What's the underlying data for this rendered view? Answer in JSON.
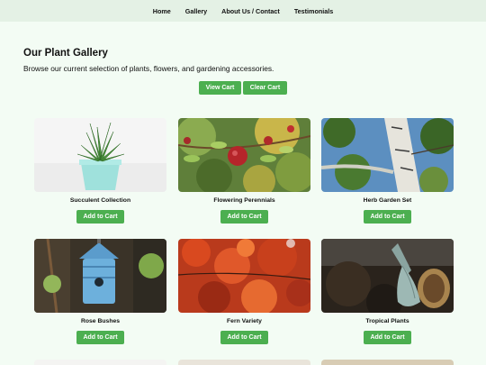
{
  "nav": {
    "items": [
      {
        "label": "Home"
      },
      {
        "label": "Gallery"
      },
      {
        "label": "About Us / Contact"
      },
      {
        "label": "Testimonials"
      }
    ]
  },
  "gallery": {
    "title": "Our Plant Gallery",
    "subtitle": "Browse our current selection of plants, flowers, and gardening accessories.",
    "view_cart_label": "View Cart",
    "clear_cart_label": "Clear Cart"
  },
  "products": [
    {
      "name": "Succulent Collection",
      "button": "Add to Cart"
    },
    {
      "name": "Flowering Perennials",
      "button": "Add to Cart"
    },
    {
      "name": "Herb Garden Set",
      "button": "Add to Cart"
    },
    {
      "name": "Rose Bushes",
      "button": "Add to Cart"
    },
    {
      "name": "Fern Variety",
      "button": "Add to Cart"
    },
    {
      "name": "Tropical Plants",
      "button": "Add to Cart"
    }
  ],
  "colors": {
    "accent": "#4caf50",
    "background": "#f3fcf4",
    "navbar": "#e4f1e5"
  }
}
